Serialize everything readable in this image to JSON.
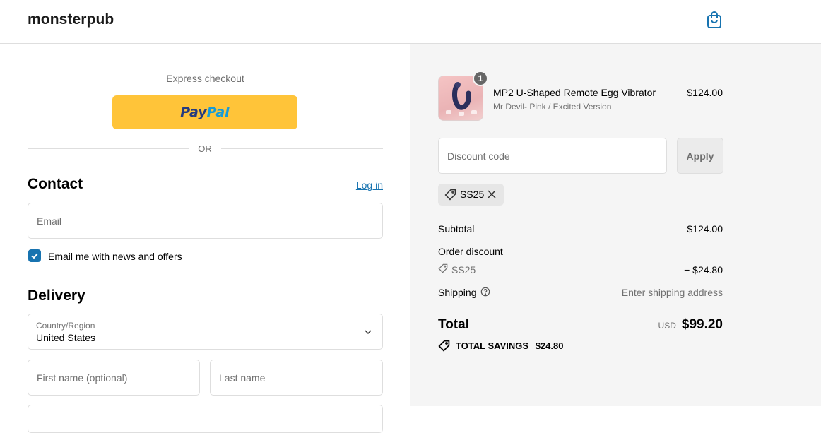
{
  "header": {
    "brand": "monsterpub"
  },
  "express": {
    "label": "Express checkout",
    "paypal_a": "Pay",
    "paypal_b": "Pal",
    "or": "OR"
  },
  "contact": {
    "heading": "Contact",
    "login": "Log in",
    "email_placeholder": "Email",
    "newsletter_label": "Email me with news and offers",
    "newsletter_checked": true
  },
  "delivery": {
    "heading": "Delivery",
    "country_label": "Country/Region",
    "country_value": "United States",
    "first_name_placeholder": "First name (optional)",
    "last_name_placeholder": "Last name"
  },
  "summary": {
    "product": {
      "quantity": "1",
      "name": "MP2 U-Shaped Remote Egg Vibrator",
      "variant": "Mr Devil- Pink / Excited Version",
      "price": "$124.00"
    },
    "discount_placeholder": "Discount code",
    "apply_label": "Apply",
    "applied_code": "SS25",
    "subtotal_label": "Subtotal",
    "subtotal_value": "$124.00",
    "order_discount_label": "Order discount",
    "discount_code": "SS25",
    "discount_value": "− $24.80",
    "shipping_label": "Shipping",
    "shipping_value": "Enter shipping address",
    "total_label": "Total",
    "currency": "USD",
    "total_value": "$99.20",
    "savings_label": "TOTAL SAVINGS",
    "savings_value": "$24.80"
  },
  "colors": {
    "accent": "#1773b0",
    "paypal_yellow": "#ffc439",
    "summary_bg": "#f5f5f5"
  }
}
